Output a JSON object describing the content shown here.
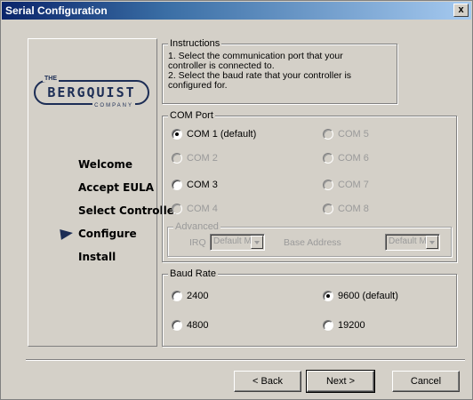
{
  "window": {
    "title": "Serial Configuration",
    "close_label": "x"
  },
  "sidebar": {
    "logo": {
      "the": "THE",
      "name": "BERGQUIST",
      "company": "COMPANY"
    },
    "steps": [
      {
        "label": "Welcome",
        "current": false
      },
      {
        "label": "Accept  EULA",
        "current": false
      },
      {
        "label": "Select Controller",
        "current": false
      },
      {
        "label": "Configure",
        "current": true
      },
      {
        "label": "Install",
        "current": false
      }
    ]
  },
  "instructions": {
    "legend": "Instructions",
    "line1": "1. Select the communication port that your",
    "line2": "controller is connected to.",
    "line3": "2. Select the baud rate that your controller is",
    "line4": "configured for."
  },
  "com_port": {
    "legend": "COM Port",
    "options": [
      {
        "label": "COM 1 (default)",
        "checked": true,
        "enabled": true
      },
      {
        "label": "COM 2",
        "checked": false,
        "enabled": false
      },
      {
        "label": "COM 3",
        "checked": false,
        "enabled": true
      },
      {
        "label": "COM 4",
        "checked": false,
        "enabled": false
      },
      {
        "label": "COM 5",
        "checked": false,
        "enabled": false
      },
      {
        "label": "COM 6",
        "checked": false,
        "enabled": false
      },
      {
        "label": "COM 7",
        "checked": false,
        "enabled": false
      },
      {
        "label": "COM 8",
        "checked": false,
        "enabled": false
      }
    ],
    "advanced": {
      "legend": "Advanced",
      "irq_label": "IRQ",
      "irq_value": "Default M",
      "base_label": "Base Address",
      "base_value": "Default M"
    }
  },
  "baud_rate": {
    "legend": "Baud Rate",
    "options": [
      {
        "label": "2400",
        "checked": false
      },
      {
        "label": "4800",
        "checked": false
      },
      {
        "label": "9600 (default)",
        "checked": true
      },
      {
        "label": "19200",
        "checked": false
      }
    ]
  },
  "buttons": {
    "back": "< Back",
    "next": "Next >",
    "cancel": "Cancel"
  }
}
